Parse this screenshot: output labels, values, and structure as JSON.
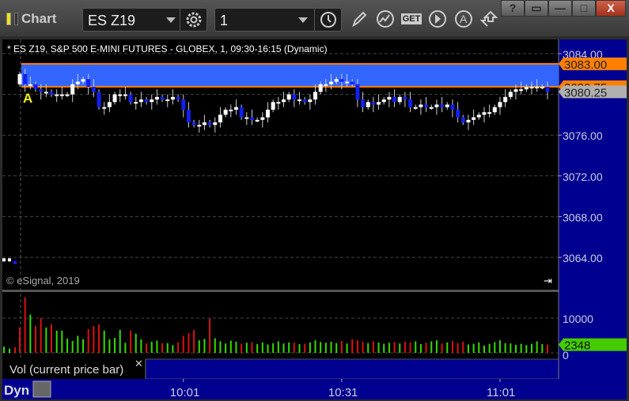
{
  "window": {
    "title": "Chart",
    "help": "?",
    "minimize": "—",
    "maximize": "□",
    "close": "X"
  },
  "toolbar": {
    "symbol": "ES Z19",
    "interval": "1",
    "icons": [
      "gear-icon",
      "clock-icon",
      "pencil-icon",
      "study-icon",
      "get-icon",
      "play-icon",
      "a-icon",
      "arrows-icon"
    ],
    "get_label": "GET"
  },
  "chart": {
    "header": "* ES Z19, S&P 500 E-MINI FUTURES - GLOBEX, 1, 09:30-16:15 (Dynamic)",
    "copyright": "© eSignal, 2019",
    "marker": "A",
    "price_ticks": [
      "3084.00",
      "3076.00",
      "3072.00",
      "3068.00",
      "3064.00"
    ],
    "price_tags": [
      {
        "label": "3083.00",
        "color": "#ff8000"
      },
      {
        "label": "3080.75",
        "color": "#ff8000"
      },
      {
        "label": "3080.25",
        "color": "#b0b0b0"
      }
    ],
    "volume_ticks": [
      "10000",
      "0"
    ],
    "volume_tag": {
      "label": "2348",
      "color": "#44cc00"
    },
    "volume_study_label": "Vol (current price bar)",
    "time_ticks": [
      "10:01",
      "10:31",
      "11:01"
    ],
    "mode_label": "Dyn",
    "colors": {
      "band": "#3366ff",
      "band_line": "#ff8000",
      "up": "#ffffff",
      "down": "#1020f0",
      "vol_up": "#33dd00",
      "vol_down": "#dd1010",
      "axis_bg": "#000090"
    }
  },
  "chart_data": {
    "type": "candlestick",
    "band": [
      3080.75,
      3083.0
    ],
    "ylim": [
      3062.5,
      3085.5
    ],
    "start_time": "09:30",
    "bar_minutes": 1,
    "prior_closes": [
      3063.75,
      3063.75,
      3063.5
    ],
    "prior_volumes": [
      1800,
      1200,
      1600
    ],
    "closes": [
      3082,
      3081,
      3081,
      3080.5,
      3080.25,
      3080.25,
      3080,
      3080,
      3080,
      3080,
      3081,
      3081.25,
      3081.5,
      3080.75,
      3080.25,
      3078.75,
      3078.75,
      3079.25,
      3080,
      3080,
      3080,
      3079.25,
      3079.25,
      3079.5,
      3079.25,
      3079.5,
      3079.75,
      3079.5,
      3079.5,
      3079.75,
      3079.5,
      3078.5,
      3077.25,
      3077,
      3077,
      3077.25,
      3077,
      3077.25,
      3078,
      3078.5,
      3078.5,
      3078.75,
      3077.75,
      3077.75,
      3077.5,
      3077.5,
      3077.75,
      3078.5,
      3079.25,
      3079.25,
      3079.5,
      3080,
      3079.5,
      3079.5,
      3079.25,
      3079.5,
      3080.25,
      3081,
      3081,
      3081.25,
      3081.5,
      3081.25,
      3081.25,
      3081,
      3079.5,
      3078.75,
      3079.25,
      3079,
      3079.25,
      3079.5,
      3079.75,
      3079.25,
      3079.75,
      3079.5,
      3078.75,
      3078.75,
      3079,
      3078.75,
      3078.75,
      3079,
      3078.75,
      3079,
      3078.5,
      3077.75,
      3077.25,
      3077.5,
      3077.75,
      3078,
      3078.25,
      3078.25,
      3078.75,
      3079.25,
      3079.75,
      3080.25,
      3080.5,
      3080.5,
      3080.75,
      3080.75,
      3080.75,
      3080.75,
      3080.25
    ],
    "volumes": [
      7300,
      16000,
      11000,
      7700,
      10000,
      7300,
      8200,
      6400,
      6400,
      4100,
      3400,
      4900,
      3900,
      6800,
      7700,
      8200,
      6400,
      3900,
      4300,
      6600,
      2900,
      6400,
      5500,
      3900,
      2700,
      3200,
      3500,
      2800,
      2800,
      2200,
      3000,
      4900,
      5700,
      6600,
      3600,
      4000,
      9800,
      4200,
      3300,
      2700,
      3500,
      3200,
      2600,
      2900,
      3100,
      2500,
      3000,
      2400,
      2800,
      3300,
      2700,
      3000,
      2900,
      2500,
      2600,
      3000,
      3600,
      3100,
      2900,
      3200,
      2800,
      3400,
      2700,
      3900,
      3600,
      3200,
      2800,
      3300,
      3000,
      2600,
      2900,
      3100,
      2700,
      3200,
      3000,
      3300,
      2500,
      2900,
      3300,
      3600,
      2700,
      3000,
      3400,
      2800,
      3200,
      2400,
      2600,
      3000,
      2100,
      2600,
      3100,
      3600,
      2800,
      2700,
      2300,
      2600,
      2200,
      2600,
      3300,
      2500,
      2348
    ],
    "volume_ylim": [
      0,
      16000
    ]
  }
}
